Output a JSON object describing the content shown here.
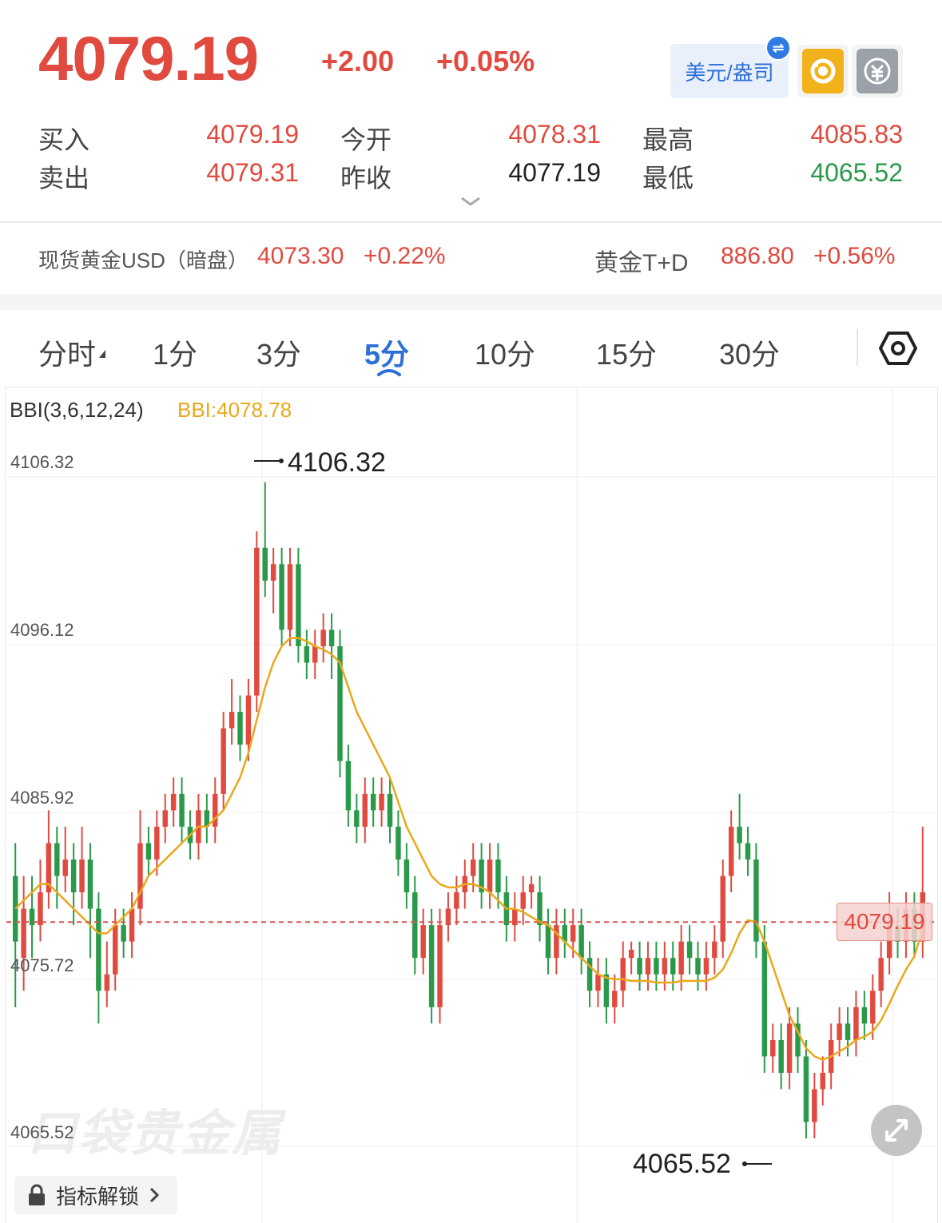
{
  "quote": {
    "price": "4079.19",
    "change": "+2.00",
    "change_pct": "+0.05%",
    "unit_label": "美元/盎司",
    "swap_glyph": "⇌",
    "bid_label": "买入",
    "bid": "4079.19",
    "ask_label": "卖出",
    "ask": "4079.31",
    "open_label": "今开",
    "open": "4078.31",
    "prev_close_label": "昨收",
    "prev_close": "4077.19",
    "high_label": "最高",
    "high": "4085.83",
    "low_label": "最低",
    "low": "4065.52"
  },
  "references": [
    {
      "name": "现货黄金USD（暗盘）",
      "price": "4073.30",
      "change_pct": "+0.22%"
    },
    {
      "name": "黄金T+D",
      "price": "886.80",
      "change_pct": "+0.56%"
    }
  ],
  "tabs": [
    {
      "label": "分时",
      "active": false
    },
    {
      "label": "1分",
      "active": false
    },
    {
      "label": "3分",
      "active": false
    },
    {
      "label": "5分",
      "active": true
    },
    {
      "label": "10分",
      "active": false
    },
    {
      "label": "15分",
      "active": false
    },
    {
      "label": "30分",
      "active": false
    }
  ],
  "indicator": {
    "name": "BBI(3,6,12,24)",
    "value_text": "BBI:4078.78"
  },
  "y_axis_labels": [
    "4106.32",
    "4096.12",
    "4085.92",
    "4075.72",
    "4065.52"
  ],
  "annotations": {
    "max_label": "4106.32",
    "min_label": "4065.52",
    "current_price_tag": "4079.19"
  },
  "watermark": "口袋贵金属",
  "unlock_label": "指标解锁",
  "colors": {
    "up": "#e04a3f",
    "down": "#2a9a4a",
    "bbi": "#e8a91a",
    "accent": "#2c6fd8"
  },
  "icons": {
    "refresh": "refresh-icon",
    "calculator": "calculator-icon",
    "settings": "settings-icon",
    "expand": "expand-icon",
    "lock": "lock-icon"
  },
  "chart_data": {
    "type": "candlestick",
    "ylim": [
      4065.52,
      4106.32
    ],
    "current_price": 4079.19,
    "candles": [
      [
        4082,
        4078,
        4084,
        4074
      ],
      [
        4077,
        4080,
        4082,
        4075
      ],
      [
        4080,
        4079,
        4082,
        4077
      ],
      [
        4079,
        4081,
        4083,
        4078
      ],
      [
        4081,
        4084,
        4086,
        4080
      ],
      [
        4084,
        4082,
        4085,
        4080
      ],
      [
        4082,
        4083,
        4085,
        4081
      ],
      [
        4083,
        4081,
        4084,
        4079
      ],
      [
        4081,
        4083,
        4085,
        4080
      ],
      [
        4083,
        4080,
        4084,
        4077
      ],
      [
        4080,
        4075,
        4081,
        4073
      ],
      [
        4075,
        4076,
        4078,
        4074
      ],
      [
        4076,
        4079,
        4080,
        4075
      ],
      [
        4079,
        4078,
        4080,
        4077
      ],
      [
        4078,
        4080,
        4081,
        4077
      ],
      [
        4080,
        4084,
        4086,
        4079
      ],
      [
        4084,
        4083,
        4085,
        4082
      ],
      [
        4083,
        4085,
        4086,
        4082
      ],
      [
        4085,
        4086,
        4087,
        4084
      ],
      [
        4086,
        4087,
        4088,
        4085
      ],
      [
        4087,
        4085,
        4088,
        4084
      ],
      [
        4085,
        4084,
        4086,
        4083
      ],
      [
        4084,
        4086,
        4087,
        4083
      ],
      [
        4086,
        4085,
        4087,
        4084
      ],
      [
        4085,
        4087,
        4088,
        4084
      ],
      [
        4087,
        4091,
        4092,
        4086
      ],
      [
        4091,
        4092,
        4094,
        4090
      ],
      [
        4092,
        4090,
        4093,
        4089
      ],
      [
        4090,
        4093,
        4094,
        4089
      ],
      [
        4093,
        4102,
        4103,
        4092
      ],
      [
        4102,
        4100,
        4106,
        4099
      ],
      [
        4100,
        4101,
        4102,
        4098
      ],
      [
        4101,
        4097,
        4102,
        4096
      ],
      [
        4097,
        4101,
        4102,
        4096
      ],
      [
        4101,
        4096,
        4102,
        4095
      ],
      [
        4096,
        4095,
        4097,
        4094
      ],
      [
        4095,
        4096,
        4097,
        4094
      ],
      [
        4096,
        4097,
        4098,
        4095
      ],
      [
        4097,
        4096,
        4098,
        4094
      ],
      [
        4096,
        4089,
        4097,
        4088
      ],
      [
        4089,
        4086,
        4090,
        4085
      ],
      [
        4086,
        4085,
        4087,
        4084
      ],
      [
        4085,
        4087,
        4088,
        4084
      ],
      [
        4087,
        4086,
        4088,
        4085
      ],
      [
        4086,
        4087,
        4088,
        4085
      ],
      [
        4087,
        4085,
        4088,
        4084
      ],
      [
        4085,
        4083,
        4086,
        4082
      ],
      [
        4083,
        4081,
        4084,
        4080
      ],
      [
        4081,
        4077,
        4082,
        4076
      ],
      [
        4077,
        4079,
        4080,
        4076
      ],
      [
        4079,
        4074,
        4080,
        4073
      ],
      [
        4074,
        4079,
        4080,
        4073
      ],
      [
        4079,
        4080,
        4081,
        4078
      ],
      [
        4080,
        4081,
        4082,
        4079
      ],
      [
        4081,
        4082,
        4083,
        4080
      ],
      [
        4082,
        4083,
        4084,
        4081
      ],
      [
        4083,
        4081,
        4084,
        4080
      ],
      [
        4081,
        4083,
        4084,
        4080
      ],
      [
        4083,
        4081,
        4084,
        4080
      ],
      [
        4081,
        4079,
        4082,
        4078
      ],
      [
        4079,
        4080,
        4081,
        4078
      ],
      [
        4080,
        4081,
        4082,
        4079
      ],
      [
        4081,
        4081.5,
        4082,
        4080
      ],
      [
        4081,
        4079,
        4082,
        4078
      ],
      [
        4079,
        4077,
        4080,
        4076
      ],
      [
        4077,
        4079,
        4080,
        4076
      ],
      [
        4079,
        4078,
        4080,
        4077
      ],
      [
        4078,
        4079,
        4080,
        4077
      ],
      [
        4079,
        4077,
        4080,
        4076
      ],
      [
        4077,
        4075,
        4078,
        4074
      ],
      [
        4075,
        4076,
        4077,
        4074
      ],
      [
        4076,
        4074,
        4077,
        4073
      ],
      [
        4074,
        4075,
        4076,
        4073
      ],
      [
        4075,
        4077,
        4078,
        4074
      ],
      [
        4077,
        4077.5,
        4078,
        4076
      ],
      [
        4077,
        4076,
        4078,
        4075
      ],
      [
        4076,
        4077,
        4078,
        4075
      ],
      [
        4077,
        4076,
        4078,
        4075
      ],
      [
        4076,
        4077,
        4078,
        4075
      ],
      [
        4077,
        4076,
        4078,
        4075
      ],
      [
        4076,
        4078,
        4079,
        4075
      ],
      [
        4078,
        4077,
        4079,
        4076
      ],
      [
        4077,
        4076,
        4078,
        4075
      ],
      [
        4076,
        4077,
        4078,
        4075
      ],
      [
        4077,
        4078,
        4079,
        4076
      ],
      [
        4078,
        4082,
        4083,
        4077
      ],
      [
        4082,
        4085,
        4086,
        4081
      ],
      [
        4085,
        4084,
        4087,
        4083
      ],
      [
        4084,
        4083,
        4085,
        4082
      ],
      [
        4083,
        4078,
        4084,
        4077
      ],
      [
        4078,
        4071,
        4079,
        4070
      ],
      [
        4071,
        4072,
        4073,
        4070
      ],
      [
        4072,
        4070,
        4073,
        4069
      ],
      [
        4070,
        4073,
        4074,
        4069
      ],
      [
        4073,
        4071,
        4074,
        4070
      ],
      [
        4071,
        4067,
        4072,
        4066
      ],
      [
        4067,
        4069,
        4070,
        4066
      ],
      [
        4069,
        4070,
        4071,
        4068
      ],
      [
        4070,
        4072,
        4073,
        4069
      ],
      [
        4072,
        4073,
        4074,
        4071
      ],
      [
        4073,
        4072,
        4074,
        4071
      ],
      [
        4072,
        4074,
        4075,
        4071
      ],
      [
        4074,
        4073,
        4075,
        4072
      ],
      [
        4073,
        4075,
        4076,
        4072
      ],
      [
        4075,
        4077,
        4078,
        4074
      ],
      [
        4077,
        4079,
        4081,
        4076
      ],
      [
        4079,
        4078,
        4080,
        4077
      ],
      [
        4078,
        4080,
        4081,
        4077
      ],
      [
        4080,
        4078,
        4081,
        4077
      ],
      [
        4078,
        4081,
        4085,
        4077
      ]
    ],
    "bbi": [
      4080,
      4080.5,
      4081,
      4081.5,
      4081.5,
      4081,
      4080.5,
      4080,
      4079.5,
      4079,
      4078.5,
      4078.5,
      4079,
      4079.5,
      4080,
      4081,
      4082,
      4082.5,
      4083,
      4083.5,
      4084,
      4084.5,
      4085,
      4085,
      4085.5,
      4086,
      4087,
      4088,
      4089.5,
      4091.5,
      4093.5,
      4095,
      4096,
      4096.5,
      4096.5,
      4096.3,
      4096,
      4095.8,
      4095.5,
      4095,
      4093.5,
      4092,
      4091,
      4090,
      4089,
      4088,
      4086.5,
      4085,
      4084,
      4083,
      4082,
      4081.5,
      4081.3,
      4081.3,
      4081.5,
      4081.5,
      4081.3,
      4081,
      4080.5,
      4080,
      4080,
      4079.8,
      4079.5,
      4079.2,
      4079,
      4078.5,
      4078,
      4077.5,
      4077,
      4076.5,
      4076,
      4075.8,
      4075.7,
      4075.7,
      4075.6,
      4075.6,
      4075.6,
      4075.5,
      4075.5,
      4075.5,
      4075.6,
      4075.6,
      4075.6,
      4075.6,
      4075.8,
      4076.3,
      4077.3,
      4078.5,
      4079.3,
      4079.2,
      4078,
      4076.5,
      4075,
      4073.5,
      4072.5,
      4071.5,
      4071,
      4070.8,
      4071,
      4071.3,
      4071.6,
      4072,
      4072.2,
      4072.5,
      4073.2,
      4074.2,
      4075.3,
      4076.3,
      4077.1,
      4078.78
    ]
  }
}
